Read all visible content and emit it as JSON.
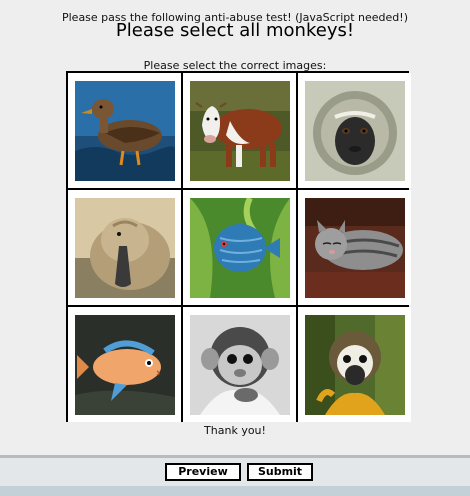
{
  "header": {
    "intro_text": "Please pass the following anti-abuse test! (JavaScript needed!)",
    "title": "Please select all monkeys!",
    "select_note": "Please select the correct images:"
  },
  "grid": {
    "images": [
      "duck",
      "cow",
      "monkey",
      "duckling",
      "fish",
      "cat",
      "fish",
      "monkey",
      "monkey"
    ]
  },
  "footer": {
    "thanks": "Thank you!"
  },
  "buttons": {
    "preview_label": "Preview",
    "submit_label": "Submit"
  }
}
